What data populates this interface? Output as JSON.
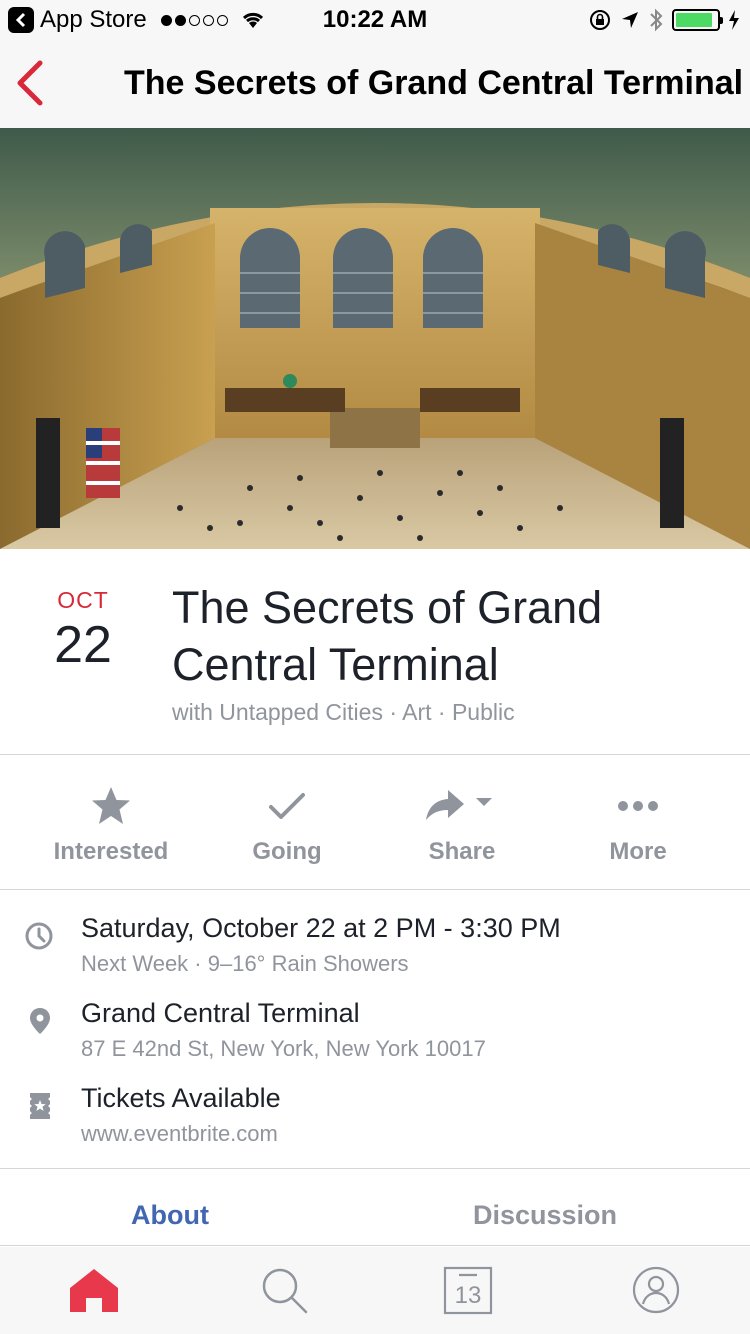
{
  "status_bar": {
    "back_app": "App Store",
    "time": "10:22 AM",
    "battery_level": 0.9
  },
  "nav": {
    "title": "The Secrets of Grand Central Terminal"
  },
  "event": {
    "month": "OCT",
    "day": "22",
    "title": "The Secrets of Grand Central Terminal",
    "subtitle": "with Untapped Cities · Art · Public"
  },
  "actions": [
    {
      "label": "Interested",
      "icon": "star-icon"
    },
    {
      "label": "Going",
      "icon": "check-icon"
    },
    {
      "label": "Share",
      "icon": "share-icon"
    },
    {
      "label": "More",
      "icon": "more-dots-icon"
    }
  ],
  "info": {
    "time": {
      "main": "Saturday, October 22 at 2 PM - 3:30 PM",
      "sub": "Next Week · 9–16° Rain Showers",
      "icon": "clock-icon"
    },
    "location": {
      "main": "Grand Central Terminal",
      "sub": "87 E 42nd St, New York, New York 10017",
      "icon": "location-pin-icon"
    },
    "tickets": {
      "main": "Tickets Available",
      "sub": "www.eventbrite.com",
      "icon": "ticket-icon"
    }
  },
  "tabs": {
    "about": "About",
    "discussion": "Discussion"
  },
  "tab_bar": {
    "calendar_day": "13",
    "active": "home"
  },
  "colors": {
    "accent_red": "#d8283a",
    "link_blue": "#4267b2",
    "secondary_gray": "#90949c"
  }
}
